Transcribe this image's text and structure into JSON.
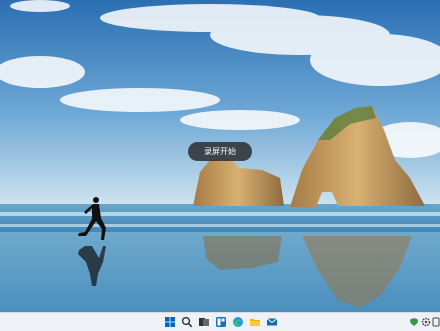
{
  "screen": {
    "toast_text": "录屏开始"
  },
  "taskbar": {
    "icons": [
      "windows-start-icon",
      "search-icon",
      "task-view-icon",
      "widgets-icon",
      "edge-browser-icon",
      "file-explorer-icon",
      "mail-icon"
    ],
    "tray_icons": [
      "shield-icon",
      "gear-icon",
      "tablet-icon"
    ],
    "accent": "#0067c0"
  },
  "colors": {
    "sky_top": "#2f74b8",
    "sea": "#5b9fc6",
    "rock": "#b8884a"
  }
}
